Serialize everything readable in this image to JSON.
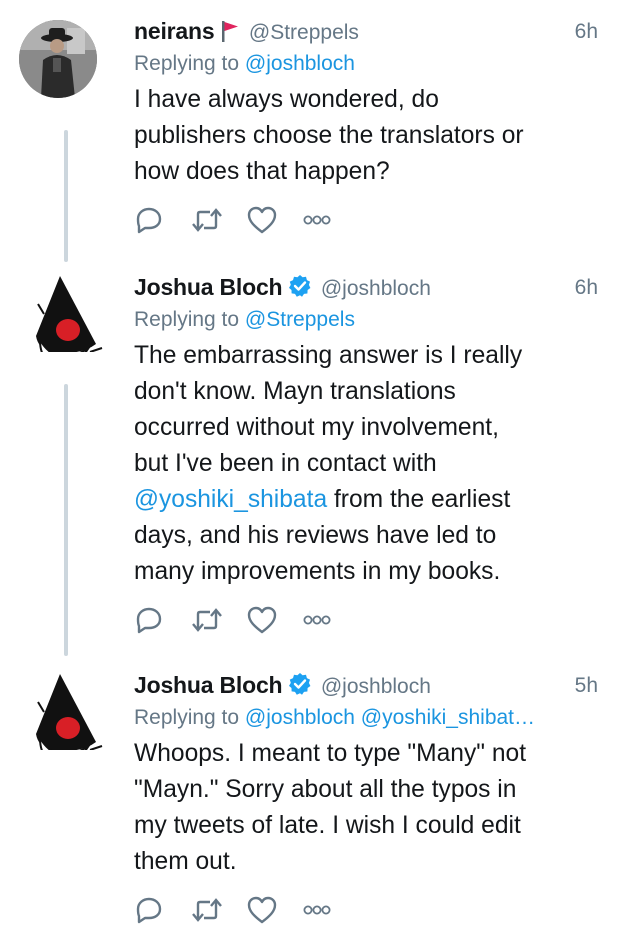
{
  "tweets": [
    {
      "name": "neirans",
      "handle": "@Streppels",
      "time": "6h",
      "replying_prefix": "Replying to ",
      "mentions": "@joshbloch",
      "text_lines": [
        "I have always wondered, do",
        "publishers choose the translators or",
        "how does that happen?"
      ],
      "avatar_icon": "user-photo",
      "badge_icon": "red-flag-icon"
    },
    {
      "name": "Joshua Bloch",
      "handle": "@joshbloch",
      "time": "6h",
      "replying_prefix": "Replying to ",
      "mentions": "@Streppels",
      "text_before_mention": "The embarrassing answer is I really\ndon't know. Mayn translations\noccurred without my involvement,\nbut I've been in contact with\n",
      "inline_mention": "@yoshiki_shibata",
      "text_after_mention": " from the earliest\ndays, and his reviews have led to\nmany improvements in my books.",
      "avatar_icon": "duke-mascot",
      "badge_icon": "verified-icon"
    },
    {
      "name": "Joshua Bloch",
      "handle": "@joshbloch",
      "time": "5h",
      "replying_prefix": "Replying to ",
      "mentions": "@joshbloch @yoshiki_shibat…",
      "text": "Whoops. I meant to type \"Many\" not\n\"Mayn.\" Sorry about all the typos in\nmy tweets of late. I wish I could edit\nthem out.",
      "avatar_icon": "duke-mascot",
      "badge_icon": "verified-icon"
    }
  ],
  "actions": [
    "reply-icon",
    "retweet-icon",
    "like-icon",
    "more-icon"
  ],
  "colors": {
    "text": "#14171a",
    "secondary": "#657786",
    "link": "#1b95e0",
    "thread_line": "#ccd6dd",
    "verified": "#1da1f2",
    "flag": "#e0245e"
  }
}
